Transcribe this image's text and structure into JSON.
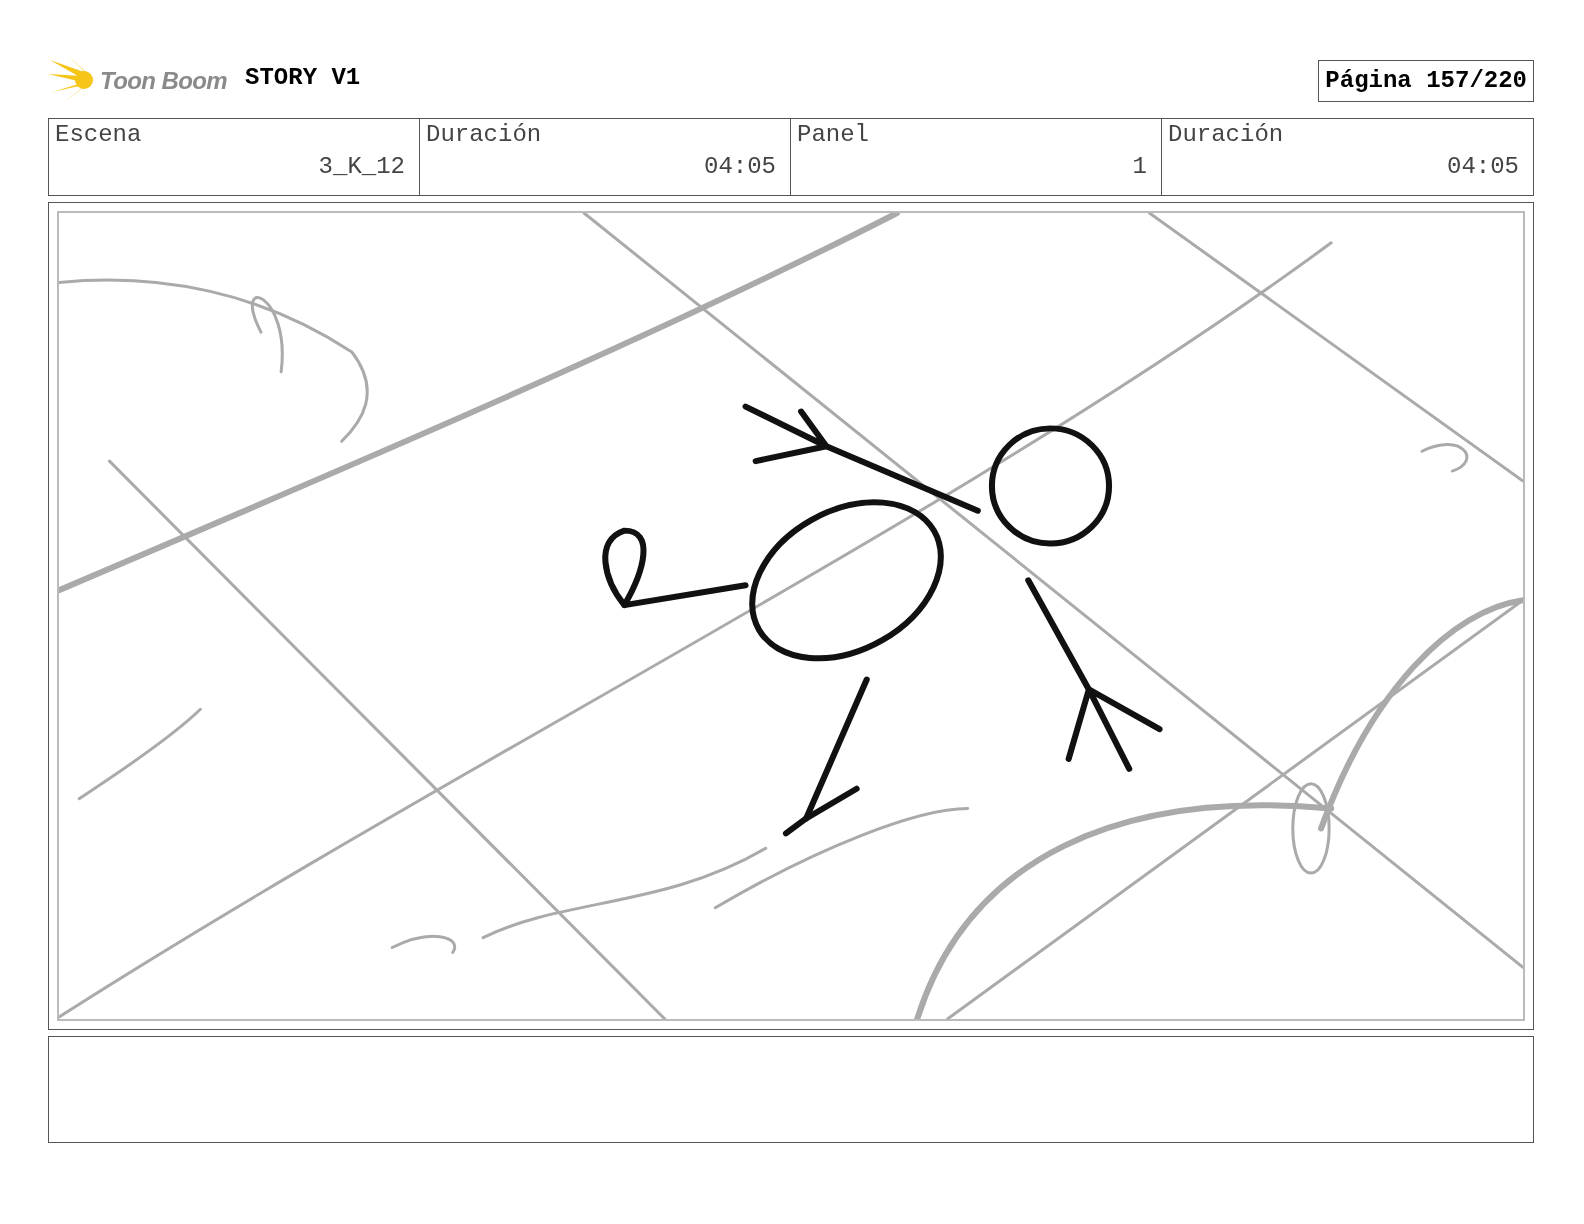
{
  "header": {
    "logo_text": "Toon Boom",
    "title": "STORY V1",
    "page": "Página 157/220"
  },
  "info": [
    {
      "label": "Escena",
      "value": "3_K_12"
    },
    {
      "label": "Duración",
      "value": "04:05"
    },
    {
      "label": "Panel",
      "value": "1"
    },
    {
      "label": "Duración",
      "value": "04:05"
    }
  ]
}
